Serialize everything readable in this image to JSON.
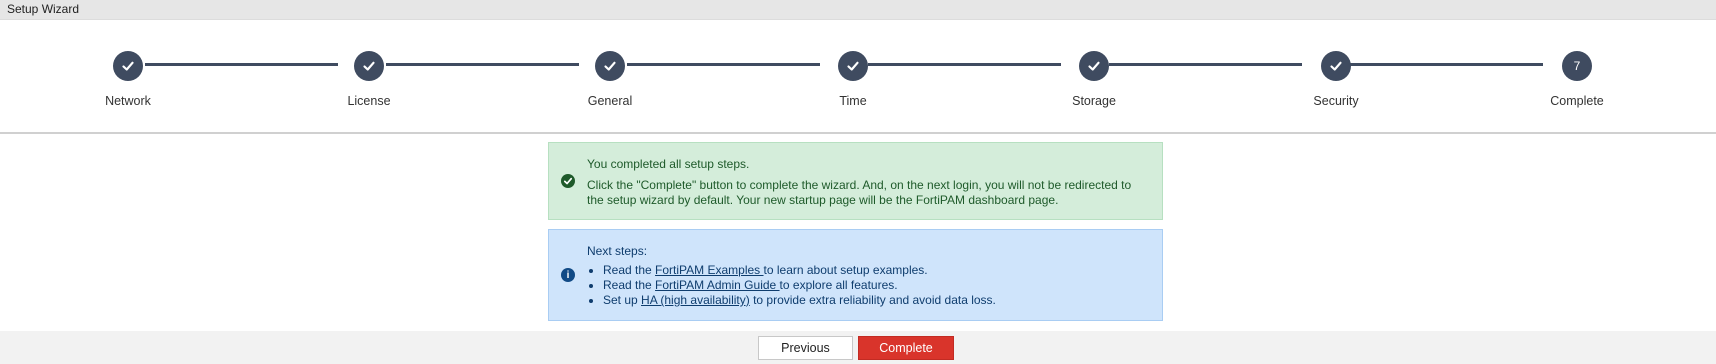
{
  "window": {
    "title": "Setup Wizard"
  },
  "steps": [
    {
      "label": "Network",
      "state": "done",
      "marker": ""
    },
    {
      "label": "License",
      "state": "done",
      "marker": ""
    },
    {
      "label": "General",
      "state": "done",
      "marker": ""
    },
    {
      "label": "Time",
      "state": "done",
      "marker": ""
    },
    {
      "label": "Storage",
      "state": "done",
      "marker": ""
    },
    {
      "label": "Security",
      "state": "done",
      "marker": ""
    },
    {
      "label": "Complete",
      "state": "current",
      "marker": "7"
    }
  ],
  "success_alert": {
    "icon": "check-circle-icon",
    "title": "You completed all setup steps.",
    "body": "Click the \"Complete\" button to complete the wizard. And, on the next login, you will not be redirected to the setup wizard by default. Your new startup page will be the FortiPAM dashboard page."
  },
  "info_alert": {
    "icon": "info-circle-icon",
    "title": "Next steps:",
    "items": [
      {
        "prefix": "Read the ",
        "link": "FortiPAM Examples ",
        "suffix": "to learn about setup examples."
      },
      {
        "prefix": "Read the ",
        "link": "FortiPAM Admin Guide ",
        "suffix": "to explore all features."
      },
      {
        "prefix": "Set up ",
        "link": "HA (high availability)",
        "suffix": " to provide extra reliability and avoid data loss."
      }
    ]
  },
  "footer": {
    "previous_label": "Previous",
    "complete_label": "Complete"
  },
  "colors": {
    "step": "#3f4b60",
    "success_bg": "#d4edda",
    "info_bg": "#cfe4fb",
    "primary_button": "#d9342b"
  }
}
